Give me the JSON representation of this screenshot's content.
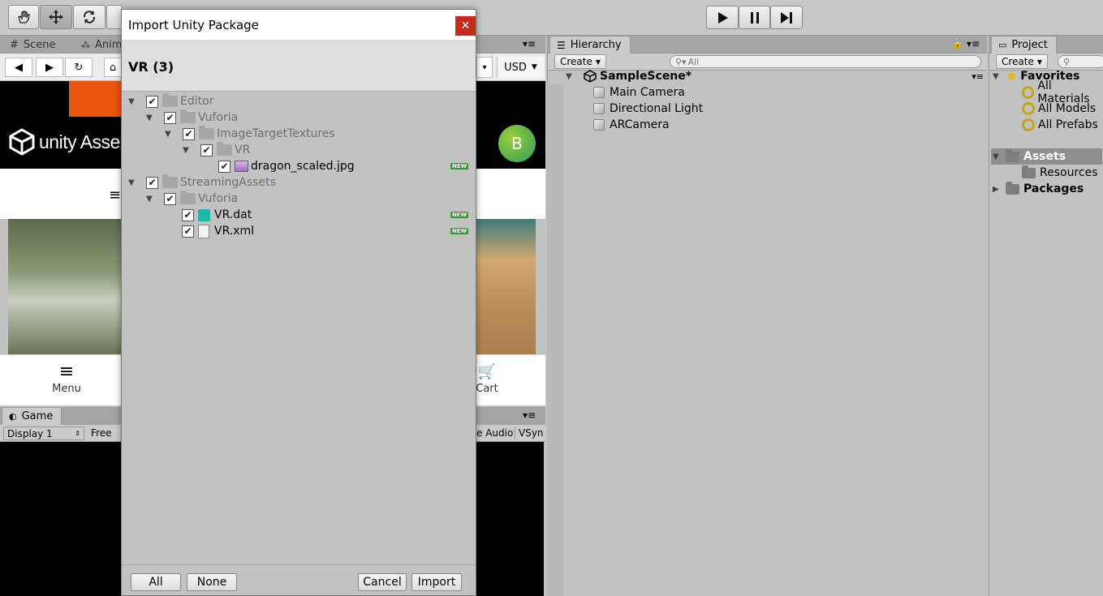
{
  "toolbar": {
    "play_icon": "play-icon",
    "pause_icon": "pause-icon",
    "step_icon": "step-icon"
  },
  "scene": {
    "tab_scene": "Scene",
    "tab_animator": "Anim",
    "currency": "USD",
    "logo_text": "unity Asse",
    "avatar_letter": "B",
    "menu_label": "Menu",
    "cart_label": "Cart"
  },
  "game": {
    "tab": "Game",
    "display": "Display 1",
    "aspect": "Free",
    "audio": "e Audio",
    "vsync": "VSyn"
  },
  "hierarchy": {
    "tab": "Hierarchy",
    "create": "Create",
    "search_placeholder": "All",
    "scene": "SampleScene*",
    "items": [
      "Main Camera",
      "Directional Light",
      "ARCamera"
    ]
  },
  "project": {
    "tab": "Project",
    "create": "Create",
    "favorites": "Favorites",
    "favorite_items": [
      "All Materials",
      "All Models",
      "All Prefabs"
    ],
    "assets": "Assets",
    "resources": "Resources",
    "packages": "Packages"
  },
  "dialog": {
    "title": "Import Unity Package",
    "package_name": "VR (3)",
    "tree": [
      "Editor",
      "Vuforia",
      "ImageTargetTextures",
      "VR",
      "dragon_scaled.jpg",
      "StreamingAssets",
      "Vuforia",
      "VR.dat",
      "VR.xml"
    ],
    "new_badge": "NEW",
    "buttons": {
      "all": "All",
      "none": "None",
      "cancel": "Cancel",
      "import": "Import"
    }
  }
}
